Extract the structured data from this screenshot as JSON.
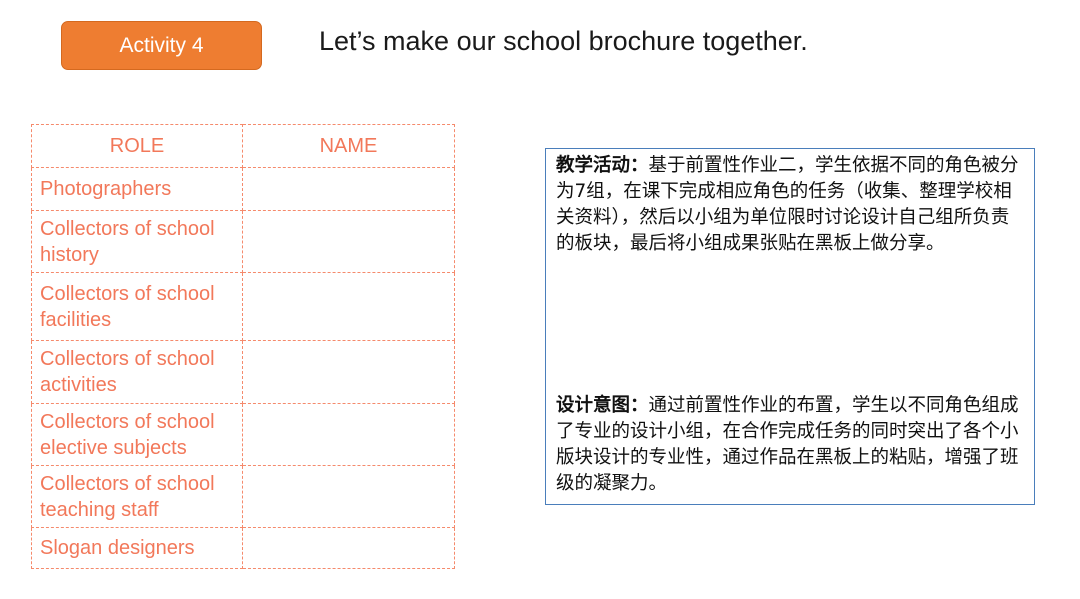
{
  "header": {
    "activity_label": "Activity 4",
    "headline": "Let’s make our school brochure together."
  },
  "colors": {
    "badge_bg": "#ee7d31",
    "table_text": "#f2785a",
    "table_border": "#f58a6c",
    "notes_border": "#4a7ebb"
  },
  "table": {
    "headers": [
      "ROLE",
      "NAME"
    ],
    "rows": [
      {
        "role": "Photographers",
        "name": ""
      },
      {
        "role": "Collectors of school history",
        "name": ""
      },
      {
        "role": "Collectors of school facilities",
        "name": ""
      },
      {
        "role": "Collectors of school activities",
        "name": ""
      },
      {
        "role": "Collectors of school elective subjects",
        "name": ""
      },
      {
        "role": "Collectors of school teaching staff",
        "name": ""
      },
      {
        "role": "Slogan designers",
        "name": ""
      }
    ]
  },
  "notes": {
    "activity_title": "教学活动：",
    "activity_text": "基于前置性作业二，学生依据不同的角色被分为7组，在课下完成相应角色的任务（收集、整理学校相关资料），然后以小组为单位限时讨论设计自己组所负责的板块，最后将小组成果张贴在黑板上做分享。",
    "design_title": "设计意图：",
    "design_text": "通过前置性作业的布置，学生以不同角色组成了专业的设计小组，在合作完成任务的同时突出了各个小版块设计的专业性，通过作品在黑板上的粘贴，增强了班级的凝聚力。"
  }
}
